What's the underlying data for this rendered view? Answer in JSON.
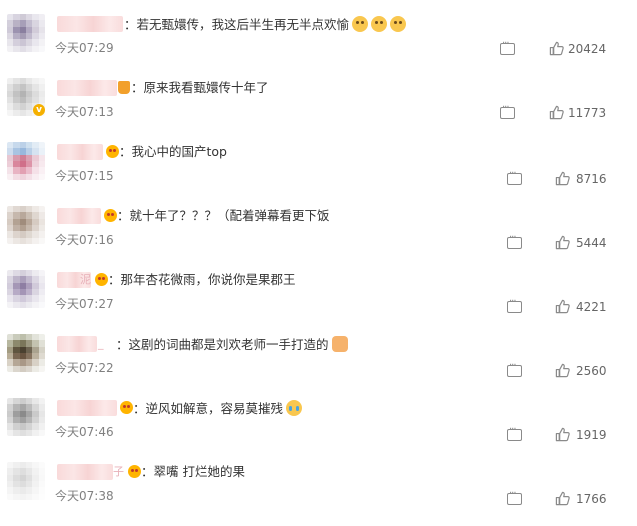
{
  "comments": [
    {
      "text": "：若无甄嬛传，我这后半生再无半点欢愉",
      "time": "今天07:29",
      "likes": "20424",
      "emojis": [
        "doge-emoji",
        "doge-emoji",
        "doge-emoji"
      ]
    },
    {
      "text": "：原来我看甄嬛传十年了",
      "time": "今天07:13",
      "likes": "11773",
      "emojis": []
    },
    {
      "text": "：我心中的国产top",
      "time": "今天07:15",
      "likes": "8716",
      "emojis": []
    },
    {
      "text": "：就十年了？？？（配着弹幕看更下饭",
      "time": "今天07:16",
      "likes": "5444",
      "emojis": []
    },
    {
      "name_suffix": "泥",
      "text": "：那年杏花微雨，你说你是果郡王",
      "time": "今天07:27",
      "likes": "4221",
      "emojis": []
    },
    {
      "name_suffix": "_",
      "text": "：这剧的词曲都是刘欢老师一手打造的",
      "time": "今天07:22",
      "likes": "2560",
      "emojis": [
        "fist-emoji"
      ]
    },
    {
      "text": "：逆风如解意，容易莫摧残",
      "time": "今天07:46",
      "likes": "1919",
      "emojis": [
        "crying-emoji"
      ]
    },
    {
      "name_suffix": "子",
      "text": "：翠嘴 打烂她的果",
      "time": "今天07:38",
      "likes": "1766",
      "emojis": []
    }
  ],
  "icons": {
    "reply": "comment-bubble-icon",
    "like": "thumbs-up-icon"
  },
  "colors": {
    "text": "#333333",
    "time": "#808080",
    "count": "#666666"
  }
}
